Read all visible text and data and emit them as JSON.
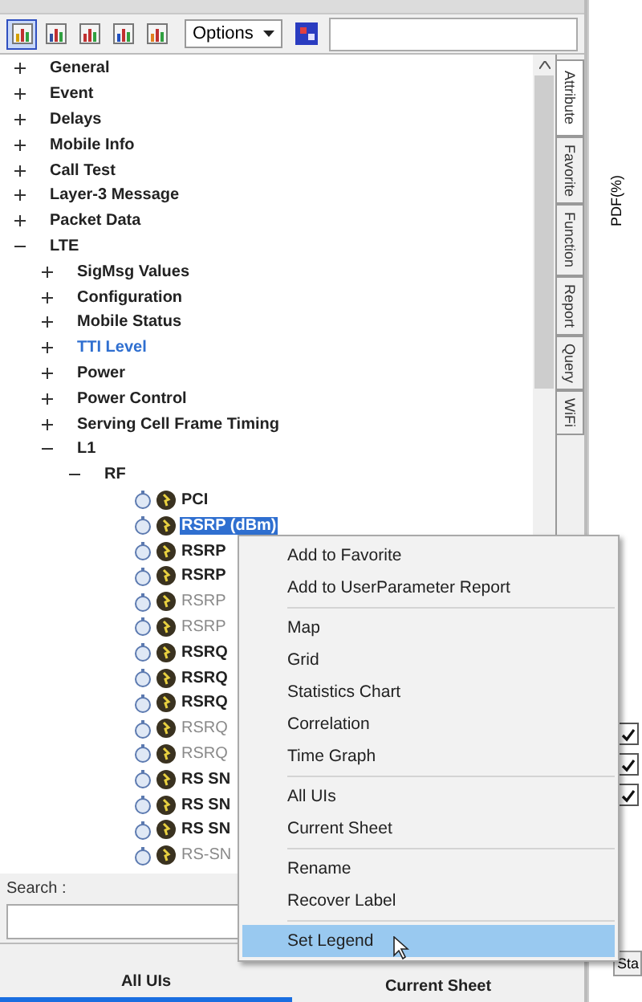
{
  "toolbar": {
    "tools": [
      {
        "selected": true
      },
      {
        "selected": false
      },
      {
        "selected": false
      },
      {
        "selected": false
      },
      {
        "selected": false
      }
    ],
    "options_dropdown": "Options"
  },
  "tree": [
    {
      "label": "General",
      "expanded": false
    },
    {
      "label": "Event",
      "expanded": false
    },
    {
      "label": "Delays",
      "expanded": false
    },
    {
      "label": "Mobile Info",
      "expanded": false
    },
    {
      "label": "Call Test",
      "expanded": false
    },
    {
      "label": "Layer-3 Message",
      "expanded": false
    },
    {
      "label": "Packet Data",
      "expanded": false
    },
    {
      "label": "LTE",
      "expanded": true,
      "children": [
        {
          "label": "SigMsg Values",
          "expanded": false
        },
        {
          "label": "Configuration",
          "expanded": false
        },
        {
          "label": "Mobile Status",
          "expanded": false
        },
        {
          "label": "TTI Level",
          "expanded": false,
          "highlighted": true
        },
        {
          "label": "Power",
          "expanded": false
        },
        {
          "label": "Power Control",
          "expanded": false
        },
        {
          "label": "Serving Cell Frame Timing",
          "expanded": false
        },
        {
          "label": "L1",
          "expanded": true,
          "children": [
            {
              "label": "RF",
              "expanded": true,
              "children": [
                {
                  "kind": "leaf",
                  "label": "PCI",
                  "disabled": false,
                  "selected": false
                },
                {
                  "kind": "leaf",
                  "label": "RSRP (dBm)",
                  "disabled": false,
                  "selected": true
                },
                {
                  "kind": "leaf",
                  "label": "RSRP",
                  "disabled": false,
                  "selected": false
                },
                {
                  "kind": "leaf",
                  "label": "RSRP",
                  "disabled": false,
                  "selected": false
                },
                {
                  "kind": "leaf",
                  "label": "RSRP",
                  "disabled": true,
                  "selected": false
                },
                {
                  "kind": "leaf",
                  "label": "RSRP",
                  "disabled": true,
                  "selected": false
                },
                {
                  "kind": "leaf",
                  "label": "RSRQ",
                  "disabled": false,
                  "selected": false
                },
                {
                  "kind": "leaf",
                  "label": "RSRQ",
                  "disabled": false,
                  "selected": false
                },
                {
                  "kind": "leaf",
                  "label": "RSRQ",
                  "disabled": false,
                  "selected": false
                },
                {
                  "kind": "leaf",
                  "label": "RSRQ",
                  "disabled": true,
                  "selected": false
                },
                {
                  "kind": "leaf",
                  "label": "RSRQ",
                  "disabled": true,
                  "selected": false
                },
                {
                  "kind": "leaf",
                  "label": "RS SN",
                  "disabled": false,
                  "selected": false
                },
                {
                  "kind": "leaf",
                  "label": "RS SN",
                  "disabled": false,
                  "selected": false
                },
                {
                  "kind": "leaf",
                  "label": "RS SN",
                  "disabled": false,
                  "selected": false
                },
                {
                  "kind": "leaf",
                  "label": "RS-SN",
                  "disabled": true,
                  "selected": false
                }
              ]
            }
          ]
        }
      ]
    }
  ],
  "side_tabs": [
    {
      "label": "Attribute",
      "selected": true
    },
    {
      "label": "Favorite",
      "selected": false
    },
    {
      "label": "Function",
      "selected": false
    },
    {
      "label": "Report",
      "selected": false
    },
    {
      "label": "Query",
      "selected": false
    },
    {
      "label": "WiFi",
      "selected": false
    }
  ],
  "search": {
    "label": "Search :"
  },
  "bottom_tabs": [
    {
      "label": "All UIs",
      "selected": true
    },
    {
      "label": "Current Sheet",
      "selected": false
    }
  ],
  "chart_axis_label": "PDF(%)",
  "right_list": [
    {
      "checked": true
    },
    {
      "checked": true
    },
    {
      "checked": true
    }
  ],
  "right_tab": "Sta",
  "context_menu": [
    {
      "kind": "item",
      "label": "Add to Favorite",
      "selected": false
    },
    {
      "kind": "item",
      "label": "Add to UserParameter Report",
      "selected": false
    },
    {
      "kind": "separator"
    },
    {
      "kind": "item",
      "label": "Map",
      "selected": false
    },
    {
      "kind": "item",
      "label": "Grid",
      "selected": false
    },
    {
      "kind": "item",
      "label": "Statistics Chart",
      "selected": false
    },
    {
      "kind": "item",
      "label": "Correlation",
      "selected": false
    },
    {
      "kind": "item",
      "label": "Time Graph",
      "selected": false
    },
    {
      "kind": "separator"
    },
    {
      "kind": "item",
      "label": "All UIs",
      "selected": false
    },
    {
      "kind": "item",
      "label": "Current Sheet",
      "selected": false
    },
    {
      "kind": "separator"
    },
    {
      "kind": "item",
      "label": "Rename",
      "selected": false
    },
    {
      "kind": "item",
      "label": "Recover Label",
      "selected": false
    },
    {
      "kind": "separator"
    },
    {
      "kind": "item",
      "label": "Set Legend",
      "selected": true
    }
  ]
}
